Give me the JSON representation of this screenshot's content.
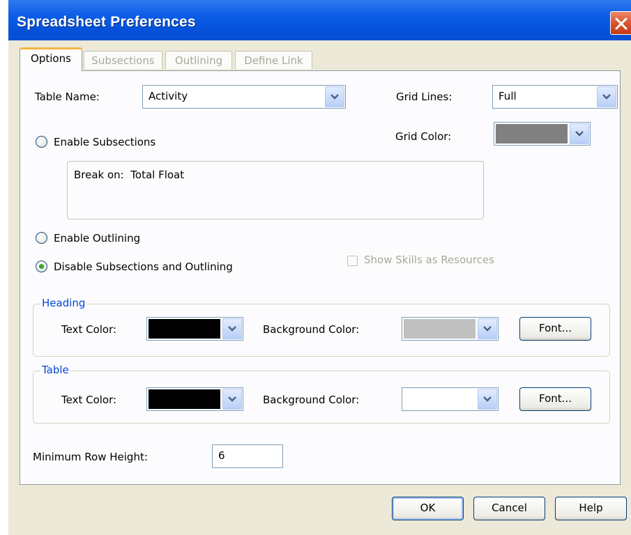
{
  "window": {
    "title": "Spreadsheet Preferences"
  },
  "tabs": [
    {
      "label": "Options",
      "active": true
    },
    {
      "label": "Subsections",
      "active": false
    },
    {
      "label": "Outlining",
      "active": false
    },
    {
      "label": "Define Link",
      "active": false
    }
  ],
  "options": {
    "table_name": {
      "label": "Table Name:",
      "value": "Activity"
    },
    "grid_lines": {
      "label": "Grid Lines:",
      "value": "Full"
    },
    "grid_color": {
      "label": "Grid Color:",
      "color": "#808080"
    },
    "enable_subsections": {
      "label": "Enable Subsections",
      "selected": false
    },
    "break_on": {
      "text": "Break on:  Total Float"
    },
    "enable_outlining": {
      "label": "Enable Outlining",
      "selected": false
    },
    "disable_both": {
      "label": "Disable Subsections and Outlining",
      "selected": true
    },
    "show_skills": {
      "label": "Show Skills as Resources",
      "checked": false,
      "enabled": false
    }
  },
  "heading": {
    "title": "Heading",
    "text_color_label": "Text Color:",
    "text_color": "#000000",
    "background_color_label": "Background Color:",
    "background_color": "#c0c0c0",
    "font_button": "Font..."
  },
  "table": {
    "title": "Table",
    "text_color_label": "Text Color:",
    "text_color": "#000000",
    "background_color_label": "Background Color:",
    "background_color": "#ffffff",
    "font_button": "Font..."
  },
  "min_row_height": {
    "label": "Minimum Row Height:",
    "value": "6"
  },
  "buttons": {
    "ok": "OK",
    "cancel": "Cancel",
    "help": "Help"
  },
  "colors": {
    "title_bar": "#0a53d8",
    "dialog_face": "#ece9d8",
    "group_title": "#0046d5",
    "active_tab_accent": "#f4b53f"
  }
}
